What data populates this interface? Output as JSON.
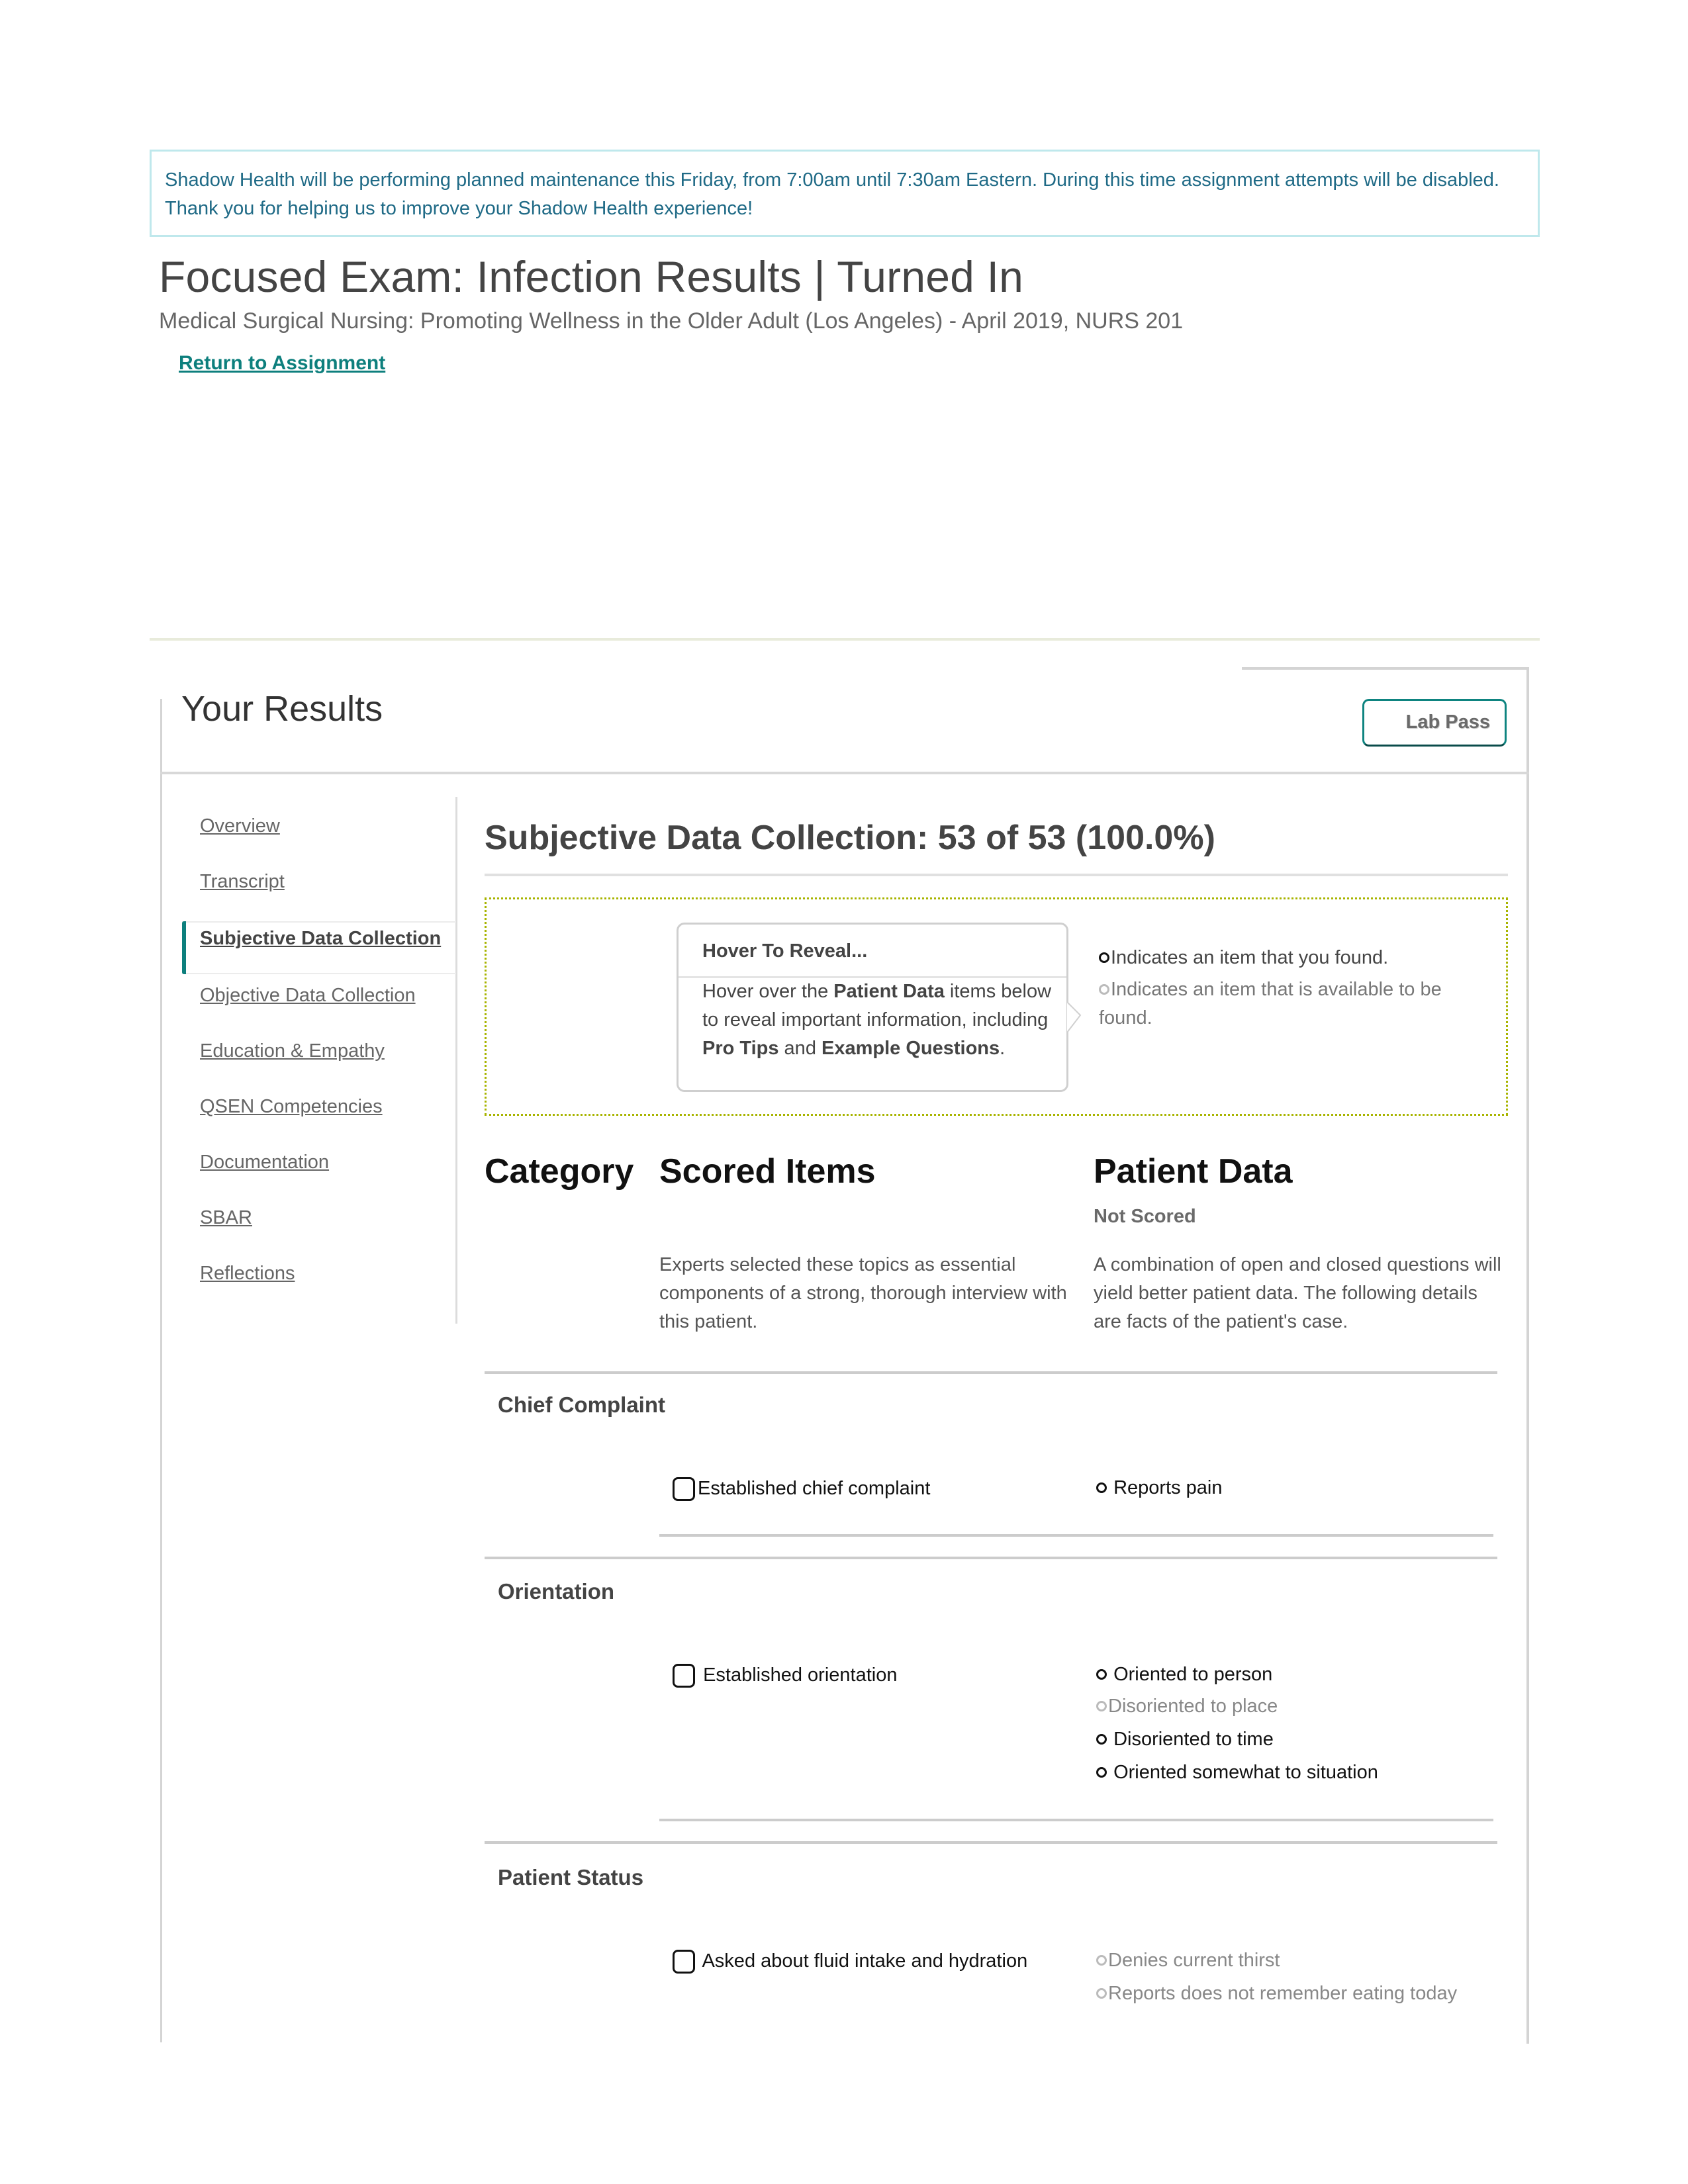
{
  "banner": {
    "text": "Shadow Health will be performing planned maintenance this Friday, from 7:00am until 7:30am Eastern. During this time assignment attempts will be disabled. Thank you for helping us to improve your Shadow Health experience!"
  },
  "header": {
    "title": "Focused Exam: Infection Results | Turned In",
    "subtitle": "Medical Surgical Nursing: Promoting Wellness in the Older Adult (Los Angeles) - April 2019, NURS 201",
    "return_link": "Return to Assignment"
  },
  "results": {
    "title": "Your Results",
    "lab_pass_label": "Lab Pass"
  },
  "sidebar": {
    "items": [
      {
        "label": "Overview",
        "active": false
      },
      {
        "label": "Transcript",
        "active": false
      },
      {
        "label": "Subjective Data Collection",
        "active": true
      },
      {
        "label": "Objective Data Collection",
        "active": false
      },
      {
        "label": "Education & Empathy",
        "active": false
      },
      {
        "label": "QSEN Competencies",
        "active": false
      },
      {
        "label": "Documentation",
        "active": false
      },
      {
        "label": "SBAR",
        "active": false
      },
      {
        "label": "Reflections",
        "active": false
      }
    ]
  },
  "main": {
    "section_title": "Subjective Data Collection: 53 of 53 (100.0%)",
    "hover_card": {
      "title": "Hover To Reveal...",
      "body_parts": [
        "Hover over the ",
        "Patient Data",
        " items below to reveal important information, including ",
        "Pro Tips",
        " and ",
        "Example Questions",
        "."
      ]
    },
    "legend": {
      "found": "Indicates an item that you found.",
      "available": "Indicates an item that is available to be found."
    },
    "columns": {
      "category": "Category",
      "scored_items": "Scored Items",
      "patient_data": "Patient Data",
      "not_scored": "Not Scored",
      "scored_desc": "Experts selected these topics as essential components of a strong, thorough interview with this patient.",
      "patient_desc": "A combination of open and closed questions will yield better patient data. The following details are facts of the patient's case."
    },
    "categories": [
      {
        "name": "Chief Complaint",
        "scored_item": "Established chief complaint",
        "patient_data": [
          {
            "text": "Reports pain",
            "found": true
          }
        ]
      },
      {
        "name": "Orientation",
        "scored_item": "Established orientation",
        "patient_data": [
          {
            "text": "Oriented to person",
            "found": true
          },
          {
            "text": "Disoriented to place",
            "found": false
          },
          {
            "text": "Disoriented to time",
            "found": true
          },
          {
            "text": "Oriented somewhat to situation",
            "found": true
          }
        ]
      },
      {
        "name": "Patient Status",
        "scored_item": "Asked about fluid intake and hydration",
        "patient_data": [
          {
            "text": "Denies current thirst",
            "found": false
          },
          {
            "text": "Reports does not remember eating today",
            "found": false
          }
        ]
      }
    ]
  }
}
